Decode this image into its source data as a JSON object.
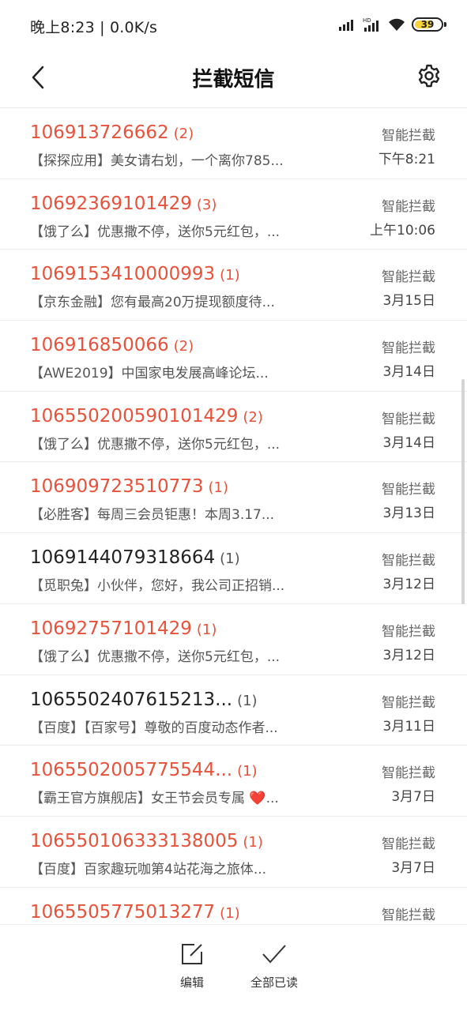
{
  "status_bar": {
    "time_speed": "晚上8:23 | 0.0K/s",
    "battery": "39"
  },
  "header": {
    "title": "拦截短信",
    "back_icon": "chevron-left-icon",
    "settings_icon": "gear-icon"
  },
  "messages": [
    {
      "sender": "106913726662",
      "count": "(2)",
      "preview": "【探探应用】美女请右划，一个离你785...",
      "tag": "智能拦截",
      "time": "下午8:21",
      "unread": true
    },
    {
      "sender": "10692369101429",
      "count": "(3)",
      "preview": "【饿了么】优惠撒不停，送你5元红包，...",
      "tag": "智能拦截",
      "time": "上午10:06",
      "unread": true
    },
    {
      "sender": "1069153410000993",
      "count": "(1)",
      "preview": "【京东金融】您有最高20万提现额度待...",
      "tag": "智能拦截",
      "time": "3月15日",
      "unread": true
    },
    {
      "sender": "106916850066",
      "count": "(2)",
      "preview": "【AWE2019】中国家电发展高峰论坛...",
      "tag": "智能拦截",
      "time": "3月14日",
      "unread": true
    },
    {
      "sender": "106550200590101429",
      "count": "(2)",
      "preview": "【饿了么】优惠撒不停，送你5元红包，...",
      "tag": "智能拦截",
      "time": "3月14日",
      "unread": true
    },
    {
      "sender": "106909723510773",
      "count": "(1)",
      "preview": "【必胜客】每周三会员钜惠！本周3.17...",
      "tag": "智能拦截",
      "time": "3月13日",
      "unread": true
    },
    {
      "sender": "1069144079318664",
      "count": "(1)",
      "preview": "【觅职兔】小伙伴，您好，我公司正招销...",
      "tag": "智能拦截",
      "time": "3月12日",
      "unread": false
    },
    {
      "sender": "10692757101429",
      "count": "(1)",
      "preview": "【饿了么】优惠撒不停，送你5元红包，...",
      "tag": "智能拦截",
      "time": "3月12日",
      "unread": true
    },
    {
      "sender": "1065502407615213...",
      "count": "(1)",
      "preview": "【百度】【百家号】尊敬的百度动态作者...",
      "tag": "智能拦截",
      "time": "3月11日",
      "unread": false
    },
    {
      "sender": "1065502005775544...",
      "count": "(1)",
      "preview": "【霸王官方旗舰店】女王节会员专属 ❤️...",
      "tag": "智能拦截",
      "time": "3月7日",
      "unread": true
    },
    {
      "sender": "106550106333138005",
      "count": "(1)",
      "preview": "【百度】百家趣玩咖第4站花海之旅体...",
      "tag": "智能拦截",
      "time": "3月7日",
      "unread": true
    },
    {
      "sender": "1065505775013277",
      "count": "(1)",
      "preview": "",
      "tag": "智能拦截",
      "time": "",
      "unread": true
    }
  ],
  "bottom_bar": {
    "edit_label": "编辑",
    "read_all_label": "全部已读"
  },
  "colors": {
    "accent_red": "#e8513a"
  }
}
